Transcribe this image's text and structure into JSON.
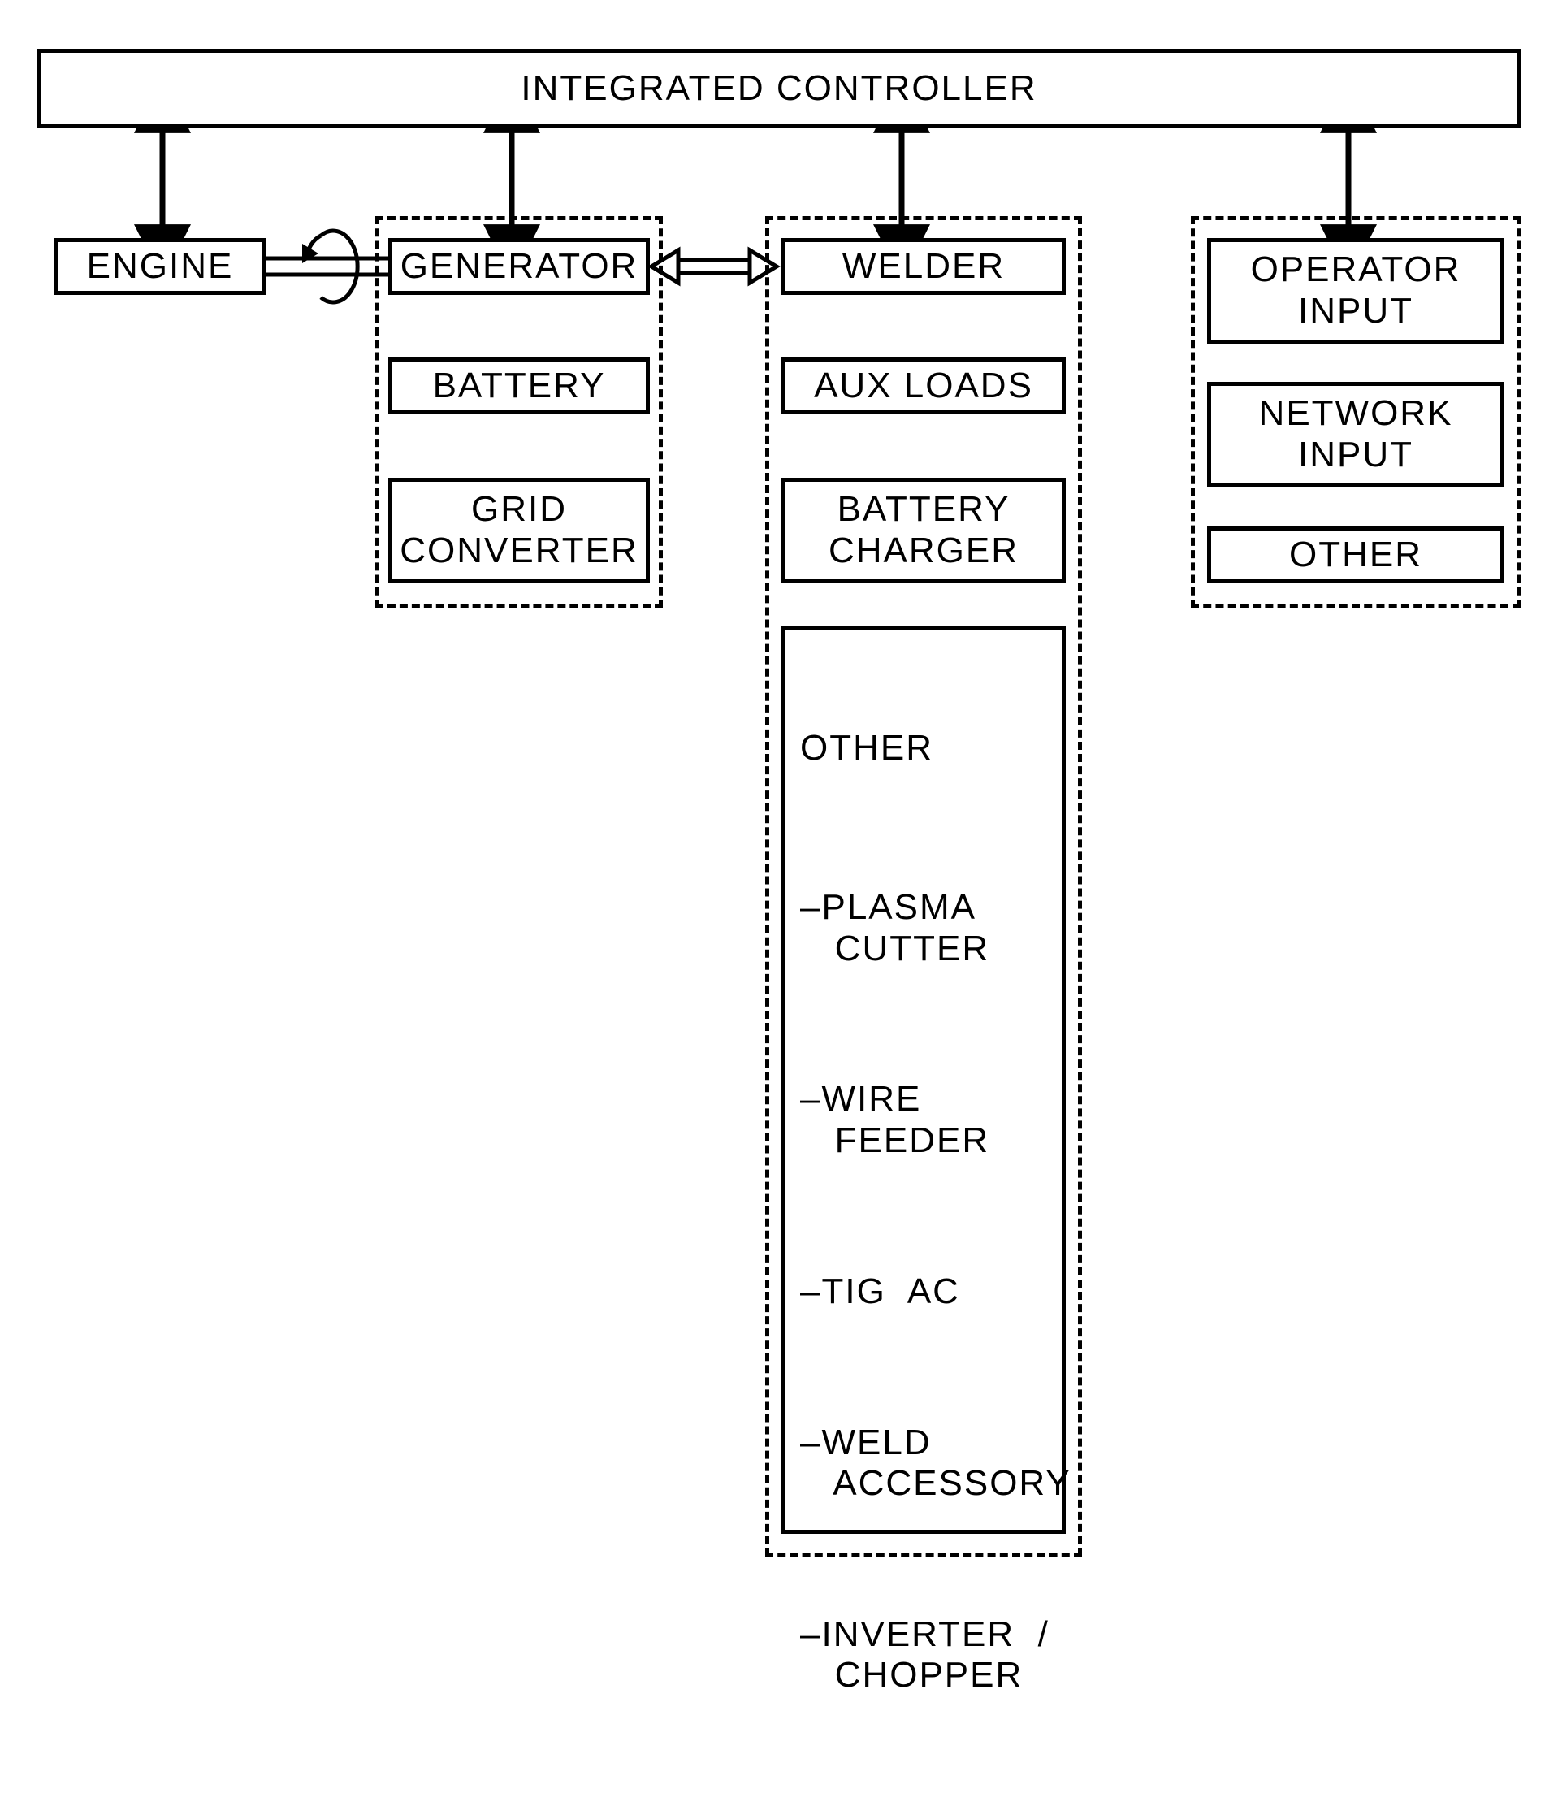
{
  "controller": {
    "title": "INTEGRATED  CONTROLLER"
  },
  "engine": {
    "label": "ENGINE"
  },
  "power_sources": {
    "generator": "GENERATOR",
    "battery": "BATTERY",
    "grid_converter": "GRID\nCONVERTER"
  },
  "loads": {
    "welder": "WELDER",
    "aux_loads": "AUX  LOADS",
    "battery_charger": "BATTERY\nCHARGER",
    "other": {
      "header": "OTHER",
      "items": [
        "–PLASMA\n   CUTTER",
        "–WIRE\n   FEEDER",
        "–TIG  AC",
        "–WELD\n   ACCESSORY",
        "–INVERTER  /\n   CHOPPER"
      ]
    }
  },
  "inputs": {
    "operator_input": "OPERATOR\nINPUT",
    "network_input": "NETWORK\nINPUT",
    "other": "OTHER"
  }
}
